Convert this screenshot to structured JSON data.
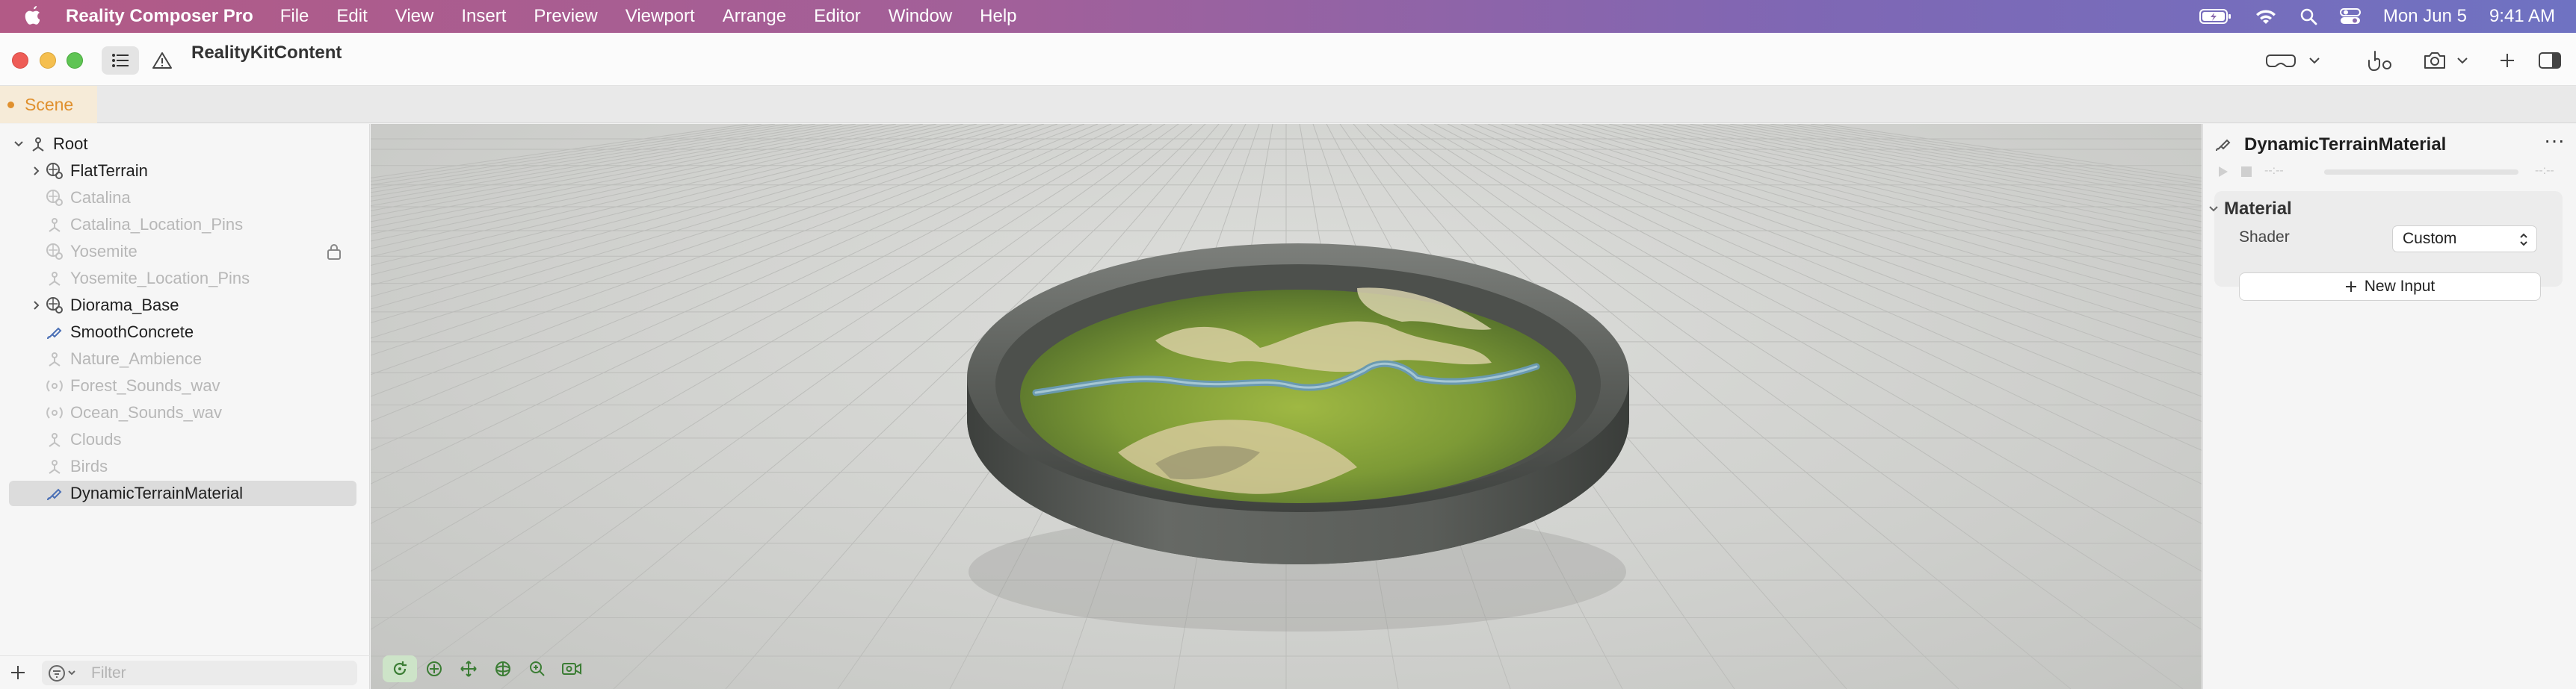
{
  "menubar": {
    "app_name": "Reality Composer Pro",
    "items": [
      "File",
      "Edit",
      "View",
      "Insert",
      "Preview",
      "Viewport",
      "Arrange",
      "Editor",
      "Window",
      "Help"
    ],
    "status": {
      "date": "Mon Jun 5",
      "time": "9:41 AM",
      "icons": [
        "battery-icon",
        "wifi-icon",
        "search-icon",
        "control-center-icon"
      ]
    }
  },
  "toolbar": {
    "document_title": "RealityKitContent",
    "buttons": [
      "list-icon",
      "warning-icon",
      "vision-pro-icon",
      "hand-gesture-icon",
      "camera-icon",
      "plus-icon",
      "inspector-toggle-icon"
    ]
  },
  "tabs": [
    {
      "label": "Scene",
      "active": true
    }
  ],
  "sidebar": {
    "root": "Root",
    "items": [
      {
        "label": "FlatTerrain",
        "icon": "entity-model-icon",
        "expandable": true,
        "dimmed": false,
        "selected": false,
        "locked": false
      },
      {
        "label": "Catalina",
        "icon": "entity-model-icon",
        "expandable": false,
        "dimmed": true,
        "selected": false,
        "locked": false
      },
      {
        "label": "Catalina_Location_Pins",
        "icon": "transform-icon",
        "expandable": false,
        "dimmed": true,
        "selected": false,
        "locked": false
      },
      {
        "label": "Yosemite",
        "icon": "entity-model-icon",
        "expandable": false,
        "dimmed": true,
        "selected": false,
        "locked": true
      },
      {
        "label": "Yosemite_Location_Pins",
        "icon": "transform-icon",
        "expandable": false,
        "dimmed": true,
        "selected": false,
        "locked": false
      },
      {
        "label": "Diorama_Base",
        "icon": "entity-model-icon",
        "expandable": true,
        "dimmed": false,
        "selected": false,
        "locked": false
      },
      {
        "label": "SmoothConcrete",
        "icon": "material-icon",
        "expandable": false,
        "dimmed": false,
        "selected": false,
        "locked": false
      },
      {
        "label": "Nature_Ambience",
        "icon": "transform-icon",
        "expandable": false,
        "dimmed": true,
        "selected": false,
        "locked": false
      },
      {
        "label": "Forest_Sounds_wav",
        "icon": "audio-icon",
        "expandable": false,
        "dimmed": true,
        "selected": false,
        "locked": false
      },
      {
        "label": "Ocean_Sounds_wav",
        "icon": "audio-icon",
        "expandable": false,
        "dimmed": true,
        "selected": false,
        "locked": false
      },
      {
        "label": "Clouds",
        "icon": "transform-icon",
        "expandable": false,
        "dimmed": true,
        "selected": false,
        "locked": false
      },
      {
        "label": "Birds",
        "icon": "transform-icon",
        "expandable": false,
        "dimmed": true,
        "selected": false,
        "locked": false
      },
      {
        "label": "DynamicTerrainMaterial",
        "icon": "material-icon",
        "expandable": false,
        "dimmed": false,
        "selected": true,
        "locked": false
      }
    ],
    "filter_placeholder": "Filter"
  },
  "viewport": {
    "tools": [
      "rotate-tool-icon",
      "select-tool-icon",
      "move-tool-icon",
      "orbit-tool-icon",
      "zoom-tool-icon",
      "camera-tool-icon"
    ]
  },
  "inspector": {
    "title": "DynamicTerrainMaterial",
    "transport": {
      "start_time": "--:--",
      "end_time": "--:--"
    },
    "section": "Material",
    "shader_label": "Shader",
    "shader_value": "Custom",
    "new_input_label": "New Input"
  },
  "colors": {
    "accent_orange": "#e0902e",
    "selection_gray": "#dcdcdc"
  }
}
